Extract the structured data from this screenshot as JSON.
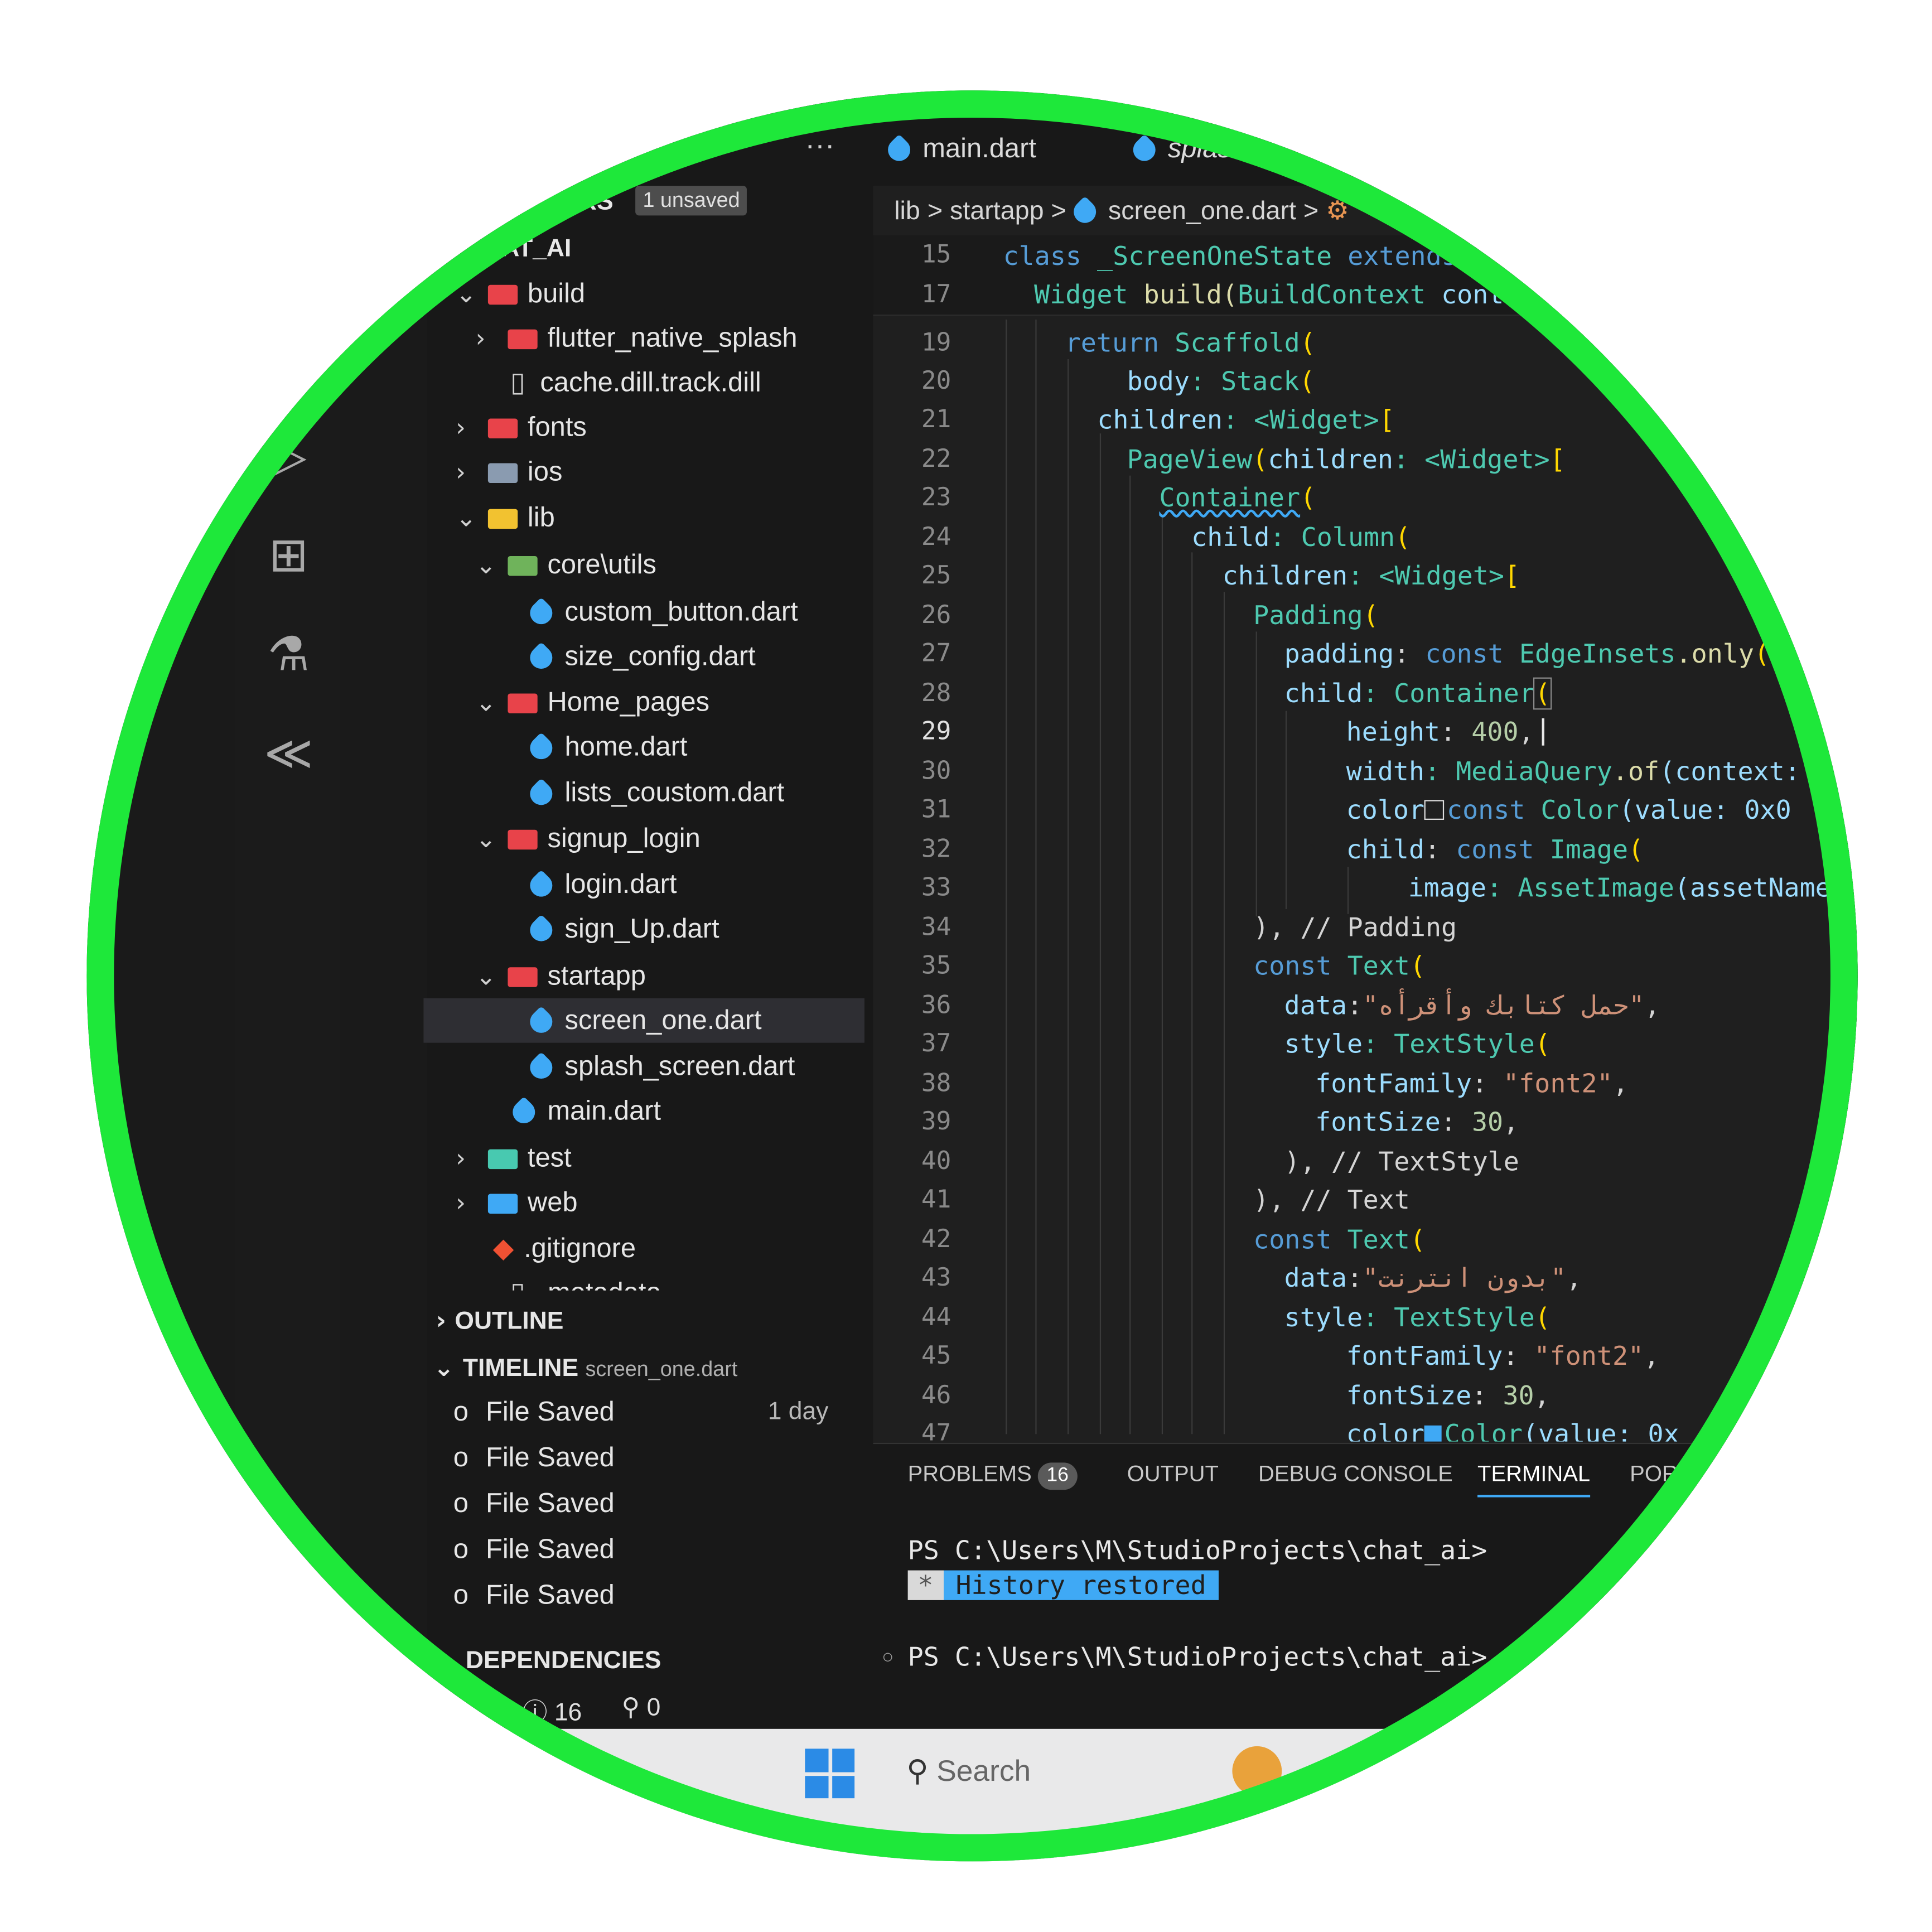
{
  "tabs": [
    {
      "label": "main.dart"
    },
    {
      "label": "splash_sc"
    }
  ],
  "sidebar": {
    "title": "…TORS",
    "unsaved_badge": "1 unsaved",
    "root": "…AT_AI",
    "more": "···",
    "items": [
      {
        "label": "build"
      },
      {
        "label": "flutter_native_splash"
      },
      {
        "label": "cache.dill.track.dill"
      },
      {
        "label": "fonts"
      },
      {
        "label": "ios"
      },
      {
        "label": "lib"
      },
      {
        "label": "core\\utils"
      },
      {
        "label": "custom_button.dart"
      },
      {
        "label": "size_config.dart"
      },
      {
        "label": "Home_pages"
      },
      {
        "label": "home.dart"
      },
      {
        "label": "lists_coustom.dart"
      },
      {
        "label": "signup_login"
      },
      {
        "label": "login.dart"
      },
      {
        "label": "sign_Up.dart"
      },
      {
        "label": "startapp"
      },
      {
        "label": "screen_one.dart"
      },
      {
        "label": "splash_screen.dart"
      },
      {
        "label": "main.dart"
      },
      {
        "label": "test"
      },
      {
        "label": "web"
      },
      {
        "label": ".gitignore"
      },
      {
        "label": ".metadata"
      }
    ],
    "outline": "OUTLINE",
    "timeline": "TIMELINE",
    "timeline_file": "screen_one.dart",
    "timeline_entries": [
      {
        "label": "File Saved",
        "time": "1 day"
      },
      {
        "label": "File Saved",
        "time": ""
      },
      {
        "label": "File Saved",
        "time": ""
      },
      {
        "label": "File Saved",
        "time": ""
      },
      {
        "label": "File Saved",
        "time": ""
      }
    ],
    "dependencies": "DEPENDENCIES"
  },
  "breadcrumb": {
    "parts": [
      "lib",
      "startapp",
      "screen_one.dart"
    ],
    "sep": ">"
  },
  "editor": {
    "line_numbers": [
      "15",
      "17",
      "19",
      "20",
      "21",
      "22",
      "23",
      "24",
      "25",
      "26",
      "27",
      "28",
      "29",
      "30",
      "31",
      "32",
      "33",
      "34",
      "35",
      "36",
      "37",
      "38",
      "39",
      "40",
      "41",
      "42",
      "43",
      "44",
      "45",
      "46",
      "47"
    ],
    "code": {
      "l15": [
        "class",
        " _ScreenOneState ",
        "extends"
      ],
      "l17": [
        "Widget",
        " build(",
        "BuildContext",
        " conte"
      ],
      "l19": [
        "return",
        " Scaffold",
        "("
      ],
      "l20": [
        "body",
        ": Stack",
        "("
      ],
      "l21": [
        "children",
        ": <Widget>",
        "["
      ],
      "l22": [
        "PageView",
        "(",
        "children",
        ": <Widget>",
        "["
      ],
      "l23": [
        "Container",
        "("
      ],
      "l24": [
        "child",
        ": Column",
        "("
      ],
      "l25": [
        "children",
        ": <Widget>",
        "["
      ],
      "l26": [
        "Padding",
        "("
      ],
      "l27": [
        "padding",
        ": ",
        "const",
        " EdgeInsets",
        ".only",
        "(t"
      ],
      "l28": [
        "child",
        ": Container",
        "("
      ],
      "l29": [
        "height",
        ": ",
        "400",
        ","
      ],
      "l30": [
        "width",
        ": MediaQuery",
        ".of",
        "(context: c"
      ],
      "l31": [
        "color",
        ": ",
        "const",
        " Color",
        "(value: 0x0"
      ],
      "l32": [
        "child",
        ": ",
        "const",
        " Image",
        "("
      ],
      "l33": [
        "image",
        ": AssetImage",
        "(assetName:"
      ],
      "l34": [
        "), ",
        "// Padding"
      ],
      "l35": [
        "const",
        " Text",
        "("
      ],
      "l36": [
        "data",
        ":",
        "\"حمل كتابك وأقرأه\"",
        ","
      ],
      "l37": [
        "style",
        ": TextStyle",
        "("
      ],
      "l38": [
        "fontFamily",
        ": ",
        "\"font2\"",
        ","
      ],
      "l39": [
        "fontSize",
        ": ",
        "30",
        ","
      ],
      "l40": [
        "), ",
        "// TextStyle"
      ],
      "l41": [
        "), ",
        "// Text"
      ],
      "l42": [
        "const",
        " Text",
        "("
      ],
      "l43": [
        "data",
        ":",
        "\"بدون انترنت\"",
        ","
      ],
      "l44": [
        "style",
        ": TextStyle",
        "("
      ],
      "l45": [
        "fontFamily",
        ": ",
        "\"font2\"",
        ","
      ],
      "l46": [
        "fontSize",
        ": ",
        "30",
        ","
      ],
      "l47": [
        "color",
        ": ",
        "Color",
        "(value: 0x"
      ]
    }
  },
  "panel": {
    "tabs": [
      "PROBLEMS",
      "OUTPUT",
      "DEBUG CONSOLE",
      "TERMINAL",
      "PORT"
    ],
    "problems_count": "16",
    "prompt1": "PS C:\\Users\\M\\StudioProjects\\chat_ai>",
    "history_star": "*",
    "history": "History restored",
    "prompt2": "PS C:\\Users\\M\\StudioProjects\\chat_ai>"
  },
  "status": {
    "problems": "16",
    "ports": "0"
  },
  "taskbar": {
    "search_placeholder": "Search"
  },
  "colors": {
    "ring": "#1ee83a",
    "accent": "#3fa9f5"
  }
}
